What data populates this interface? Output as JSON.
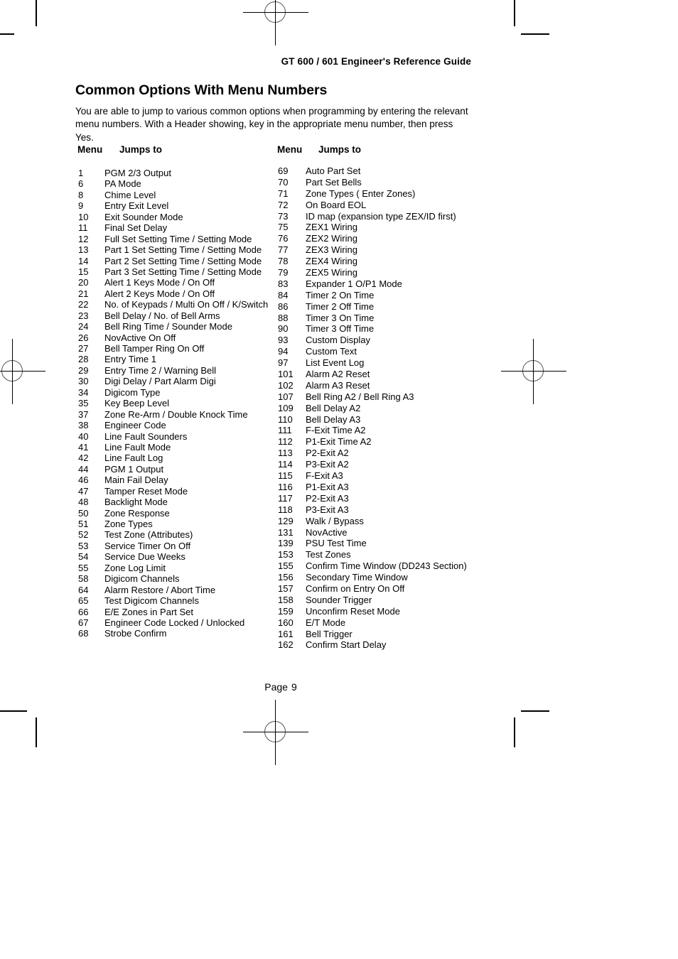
{
  "document": {
    "running_head": "GT 600 / 601 Engineer's Reference Guide",
    "title": "Common Options With Menu Numbers",
    "intro": "You are able to jump to various common options when programming by entering the relevant menu numbers. With a Header showing, key in the appropriate  menu number, then press Yes.",
    "page_label": "Page",
    "page_value": "9"
  },
  "columns": {
    "headers": {
      "menu": "Menu",
      "jumps_to": "Jumps to"
    },
    "left": [
      {
        "num": "1",
        "label": "PGM 2/3 Output"
      },
      {
        "num": "6",
        "label": "PA Mode"
      },
      {
        "num": "8",
        "label": "Chime Level"
      },
      {
        "num": "9",
        "label": "Entry Exit Level"
      },
      {
        "num": "10",
        "label": "Exit Sounder Mode"
      },
      {
        "num": "11",
        "label": "Final Set Delay"
      },
      {
        "num": "12",
        "label": "Full Set Setting Time / Setting Mode"
      },
      {
        "num": "13",
        "label": "Part 1 Set Setting Time / Setting Mode"
      },
      {
        "num": "14",
        "label": "Part 2 Set Setting Time / Setting Mode"
      },
      {
        "num": "15",
        "label": "Part 3 Set Setting Time / Setting Mode"
      },
      {
        "num": "20",
        "label": "Alert 1 Keys Mode / On Off"
      },
      {
        "num": "21",
        "label": "Alert 2 Keys Mode / On Off"
      },
      {
        "num": "22",
        "label": "No. of Keypads / Multi On Off / K/Switch"
      },
      {
        "num": "23",
        "label": "Bell Delay / No. of Bell Arms"
      },
      {
        "num": "24",
        "label": "Bell Ring Time / Sounder Mode"
      },
      {
        "num": "26",
        "label": "NovActive On Off"
      },
      {
        "num": "27",
        "label": "Bell Tamper Ring On Off"
      },
      {
        "num": "28",
        "label": "Entry Time 1"
      },
      {
        "num": "29",
        "label": "Entry Time 2 / Warning Bell"
      },
      {
        "num": "30",
        "label": "Digi Delay / Part Alarm Digi"
      },
      {
        "num": "34",
        "label": "Digicom Type"
      },
      {
        "num": "35",
        "label": "Key Beep Level"
      },
      {
        "num": "37",
        "label": "Zone Re-Arm / Double Knock Time"
      },
      {
        "num": "38",
        "label": "Engineer Code"
      },
      {
        "num": "40",
        "label": "Line Fault Sounders"
      },
      {
        "num": "41",
        "label": "Line Fault Mode"
      },
      {
        "num": "42",
        "label": "Line Fault Log"
      },
      {
        "num": "44",
        "label": "PGM 1 Output"
      },
      {
        "num": "46",
        "label": "Main Fail Delay"
      },
      {
        "num": "47",
        "label": "Tamper Reset Mode"
      },
      {
        "num": "48",
        "label": "Backlight Mode"
      },
      {
        "num": "50",
        "label": "Zone Response"
      },
      {
        "num": "51",
        "label": "Zone Types"
      },
      {
        "num": "52",
        "label": "Test Zone (Attributes)"
      },
      {
        "num": "53",
        "label": "Service Timer On Off"
      },
      {
        "num": "54",
        "label": "Service Due Weeks"
      },
      {
        "num": "55",
        "label": "Zone Log Limit"
      },
      {
        "num": "58",
        "label": "Digicom Channels"
      },
      {
        "num": "64",
        "label": "Alarm Restore / Abort Time"
      },
      {
        "num": "65",
        "label": "Test Digicom Channels"
      },
      {
        "num": "66",
        "label": "E/E Zones in Part Set"
      },
      {
        "num": "67",
        "label": "Engineer Code Locked / Unlocked"
      },
      {
        "num": "68",
        "label": "Strobe Confirm"
      }
    ],
    "right": [
      {
        "num": "69",
        "label": "Auto Part Set"
      },
      {
        "num": "70",
        "label": "Part Set Bells"
      },
      {
        "num": "71",
        "label": "Zone Types ( Enter Zones)"
      },
      {
        "num": "72",
        "label": "On Board EOL"
      },
      {
        "num": "73",
        "label": "ID map (expansion type ZEX/ID first)"
      },
      {
        "num": "75",
        "label": "ZEX1 Wiring"
      },
      {
        "num": "76",
        "label": "ZEX2 Wiring"
      },
      {
        "num": "77",
        "label": "ZEX3 Wiring"
      },
      {
        "num": "78",
        "label": "ZEX4 Wiring"
      },
      {
        "num": "79",
        "label": "ZEX5 Wiring"
      },
      {
        "num": "83",
        "label": "Expander 1 O/P1 Mode"
      },
      {
        "num": "84",
        "label": "Timer 2 On Time"
      },
      {
        "num": "86",
        "label": "Timer 2 Off Time"
      },
      {
        "num": "88",
        "label": "Timer 3 On Time"
      },
      {
        "num": "90",
        "label": "Timer 3 Off Time"
      },
      {
        "num": "93",
        "label": "Custom Display"
      },
      {
        "num": "94",
        "label": "Custom Text"
      },
      {
        "num": "97",
        "label": "List Event Log"
      },
      {
        "num": "101",
        "label": "Alarm A2 Reset"
      },
      {
        "num": "102",
        "label": "Alarm A3 Reset"
      },
      {
        "num": "107",
        "label": "Bell Ring A2 / Bell Ring A3"
      },
      {
        "num": "109",
        "label": "Bell Delay A2"
      },
      {
        "num": "110",
        "label": "Bell Delay A3"
      },
      {
        "num": "111",
        "label": "F-Exit Time A2"
      },
      {
        "num": "112",
        "label": "P1-Exit Time A2"
      },
      {
        "num": "113",
        "label": "P2-Exit A2"
      },
      {
        "num": "114",
        "label": "P3-Exit A2"
      },
      {
        "num": "115",
        "label": "F-Exit A3"
      },
      {
        "num": "116",
        "label": "P1-Exit A3"
      },
      {
        "num": "117",
        "label": "P2-Exit A3"
      },
      {
        "num": "118",
        "label": "P3-Exit A3"
      },
      {
        "num": "129",
        "label": "Walk / Bypass"
      },
      {
        "num": "131",
        "label": "NovActive"
      },
      {
        "num": "139",
        "label": "PSU Test Time"
      },
      {
        "num": "153",
        "label": "Test Zones"
      },
      {
        "num": "155",
        "label": "Confirm Time Window (DD243 Section)"
      },
      {
        "num": "156",
        "label": "Secondary Time Window"
      },
      {
        "num": "157",
        "label": "Confirm on Entry On Off"
      },
      {
        "num": "158",
        "label": "Sounder Trigger"
      },
      {
        "num": "159",
        "label": "Unconfirm Reset Mode"
      },
      {
        "num": "160",
        "label": "E/T Mode"
      },
      {
        "num": "161",
        "label": "Bell Trigger"
      },
      {
        "num": "162",
        "label": "Confirm Start Delay"
      }
    ]
  }
}
